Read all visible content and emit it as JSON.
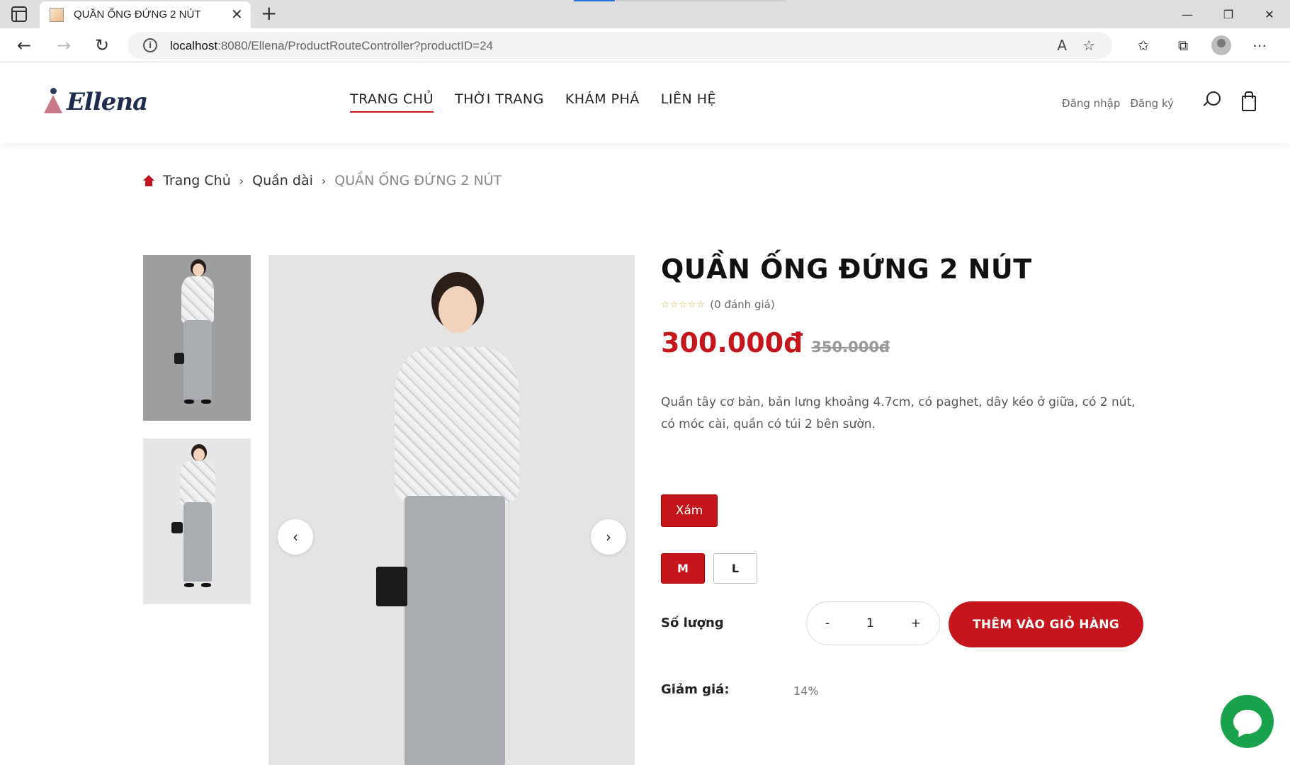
{
  "browser": {
    "tab_title": "QUẦN ỐNG ĐỨNG 2 NÚT",
    "url_host": "localhost",
    "url_rest": ":8080/Ellena/ProductRouteController?productID=24"
  },
  "site": {
    "logo": "Ellena",
    "nav": [
      "TRANG CHỦ",
      "THỜI TRANG",
      "KHÁM PHÁ",
      "LIÊN HỆ"
    ],
    "login": "Đăng nhập",
    "register": "Đăng ký"
  },
  "breadcrumb": {
    "home": "Trang Chủ",
    "category": "Quần dài",
    "current": "QUẦN ỐNG ĐỨNG 2 NÚT"
  },
  "product": {
    "title": "QUẦN ỐNG ĐỨNG 2 NÚT",
    "stars": "☆☆☆☆☆",
    "rating_text": "(0 đánh giá)",
    "price": "300.000đ",
    "old_price": "350.000đ",
    "description": "Quần tây cơ bản, bản lưng khoảng 4.7cm, có paghet, dây kéo ở giữa, có 2 nút, có móc cài, quần có túi 2 bên sườn.",
    "color": "Xám",
    "sizes": [
      "M",
      "L"
    ],
    "qty_label": "Số lượng",
    "qty_minus": "-",
    "qty_value": "1",
    "qty_plus": "+",
    "add_to_cart": "THÊM VÀO GIỎ HÀNG",
    "discount_label": "Giảm giá:",
    "discount_value": "14%"
  },
  "colors": {
    "accent": "#c4161c",
    "chat": "#1aa14c"
  }
}
